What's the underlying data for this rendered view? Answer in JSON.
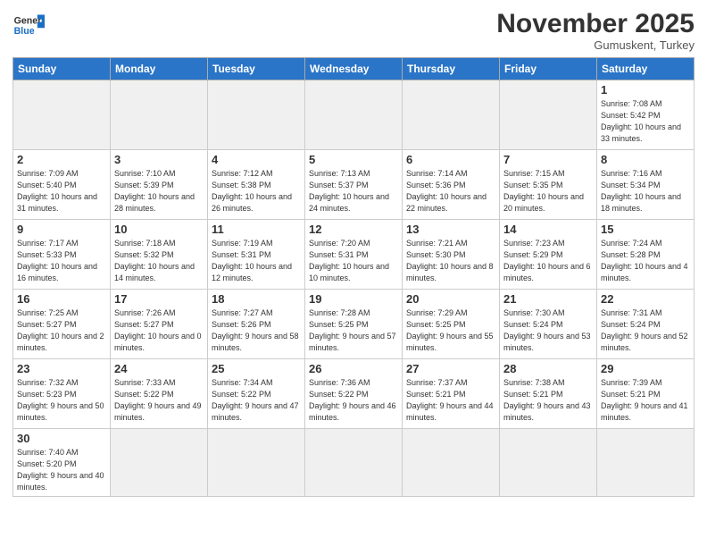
{
  "logo": {
    "general": "General",
    "blue": "Blue"
  },
  "header": {
    "month_year": "November 2025",
    "location": "Gumuskent, Turkey"
  },
  "weekdays": [
    "Sunday",
    "Monday",
    "Tuesday",
    "Wednesday",
    "Thursday",
    "Friday",
    "Saturday"
  ],
  "weeks": [
    [
      {
        "day": "",
        "info": ""
      },
      {
        "day": "",
        "info": ""
      },
      {
        "day": "",
        "info": ""
      },
      {
        "day": "",
        "info": ""
      },
      {
        "day": "",
        "info": ""
      },
      {
        "day": "",
        "info": ""
      },
      {
        "day": "1",
        "info": "Sunrise: 7:08 AM\nSunset: 5:42 PM\nDaylight: 10 hours and 33 minutes."
      }
    ],
    [
      {
        "day": "2",
        "info": "Sunrise: 7:09 AM\nSunset: 5:40 PM\nDaylight: 10 hours and 31 minutes."
      },
      {
        "day": "3",
        "info": "Sunrise: 7:10 AM\nSunset: 5:39 PM\nDaylight: 10 hours and 28 minutes."
      },
      {
        "day": "4",
        "info": "Sunrise: 7:12 AM\nSunset: 5:38 PM\nDaylight: 10 hours and 26 minutes."
      },
      {
        "day": "5",
        "info": "Sunrise: 7:13 AM\nSunset: 5:37 PM\nDaylight: 10 hours and 24 minutes."
      },
      {
        "day": "6",
        "info": "Sunrise: 7:14 AM\nSunset: 5:36 PM\nDaylight: 10 hours and 22 minutes."
      },
      {
        "day": "7",
        "info": "Sunrise: 7:15 AM\nSunset: 5:35 PM\nDaylight: 10 hours and 20 minutes."
      },
      {
        "day": "8",
        "info": "Sunrise: 7:16 AM\nSunset: 5:34 PM\nDaylight: 10 hours and 18 minutes."
      }
    ],
    [
      {
        "day": "9",
        "info": "Sunrise: 7:17 AM\nSunset: 5:33 PM\nDaylight: 10 hours and 16 minutes."
      },
      {
        "day": "10",
        "info": "Sunrise: 7:18 AM\nSunset: 5:32 PM\nDaylight: 10 hours and 14 minutes."
      },
      {
        "day": "11",
        "info": "Sunrise: 7:19 AM\nSunset: 5:31 PM\nDaylight: 10 hours and 12 minutes."
      },
      {
        "day": "12",
        "info": "Sunrise: 7:20 AM\nSunset: 5:31 PM\nDaylight: 10 hours and 10 minutes."
      },
      {
        "day": "13",
        "info": "Sunrise: 7:21 AM\nSunset: 5:30 PM\nDaylight: 10 hours and 8 minutes."
      },
      {
        "day": "14",
        "info": "Sunrise: 7:23 AM\nSunset: 5:29 PM\nDaylight: 10 hours and 6 minutes."
      },
      {
        "day": "15",
        "info": "Sunrise: 7:24 AM\nSunset: 5:28 PM\nDaylight: 10 hours and 4 minutes."
      }
    ],
    [
      {
        "day": "16",
        "info": "Sunrise: 7:25 AM\nSunset: 5:27 PM\nDaylight: 10 hours and 2 minutes."
      },
      {
        "day": "17",
        "info": "Sunrise: 7:26 AM\nSunset: 5:27 PM\nDaylight: 10 hours and 0 minutes."
      },
      {
        "day": "18",
        "info": "Sunrise: 7:27 AM\nSunset: 5:26 PM\nDaylight: 9 hours and 58 minutes."
      },
      {
        "day": "19",
        "info": "Sunrise: 7:28 AM\nSunset: 5:25 PM\nDaylight: 9 hours and 57 minutes."
      },
      {
        "day": "20",
        "info": "Sunrise: 7:29 AM\nSunset: 5:25 PM\nDaylight: 9 hours and 55 minutes."
      },
      {
        "day": "21",
        "info": "Sunrise: 7:30 AM\nSunset: 5:24 PM\nDaylight: 9 hours and 53 minutes."
      },
      {
        "day": "22",
        "info": "Sunrise: 7:31 AM\nSunset: 5:24 PM\nDaylight: 9 hours and 52 minutes."
      }
    ],
    [
      {
        "day": "23",
        "info": "Sunrise: 7:32 AM\nSunset: 5:23 PM\nDaylight: 9 hours and 50 minutes."
      },
      {
        "day": "24",
        "info": "Sunrise: 7:33 AM\nSunset: 5:22 PM\nDaylight: 9 hours and 49 minutes."
      },
      {
        "day": "25",
        "info": "Sunrise: 7:34 AM\nSunset: 5:22 PM\nDaylight: 9 hours and 47 minutes."
      },
      {
        "day": "26",
        "info": "Sunrise: 7:36 AM\nSunset: 5:22 PM\nDaylight: 9 hours and 46 minutes."
      },
      {
        "day": "27",
        "info": "Sunrise: 7:37 AM\nSunset: 5:21 PM\nDaylight: 9 hours and 44 minutes."
      },
      {
        "day": "28",
        "info": "Sunrise: 7:38 AM\nSunset: 5:21 PM\nDaylight: 9 hours and 43 minutes."
      },
      {
        "day": "29",
        "info": "Sunrise: 7:39 AM\nSunset: 5:21 PM\nDaylight: 9 hours and 41 minutes."
      }
    ],
    [
      {
        "day": "30",
        "info": "Sunrise: 7:40 AM\nSunset: 5:20 PM\nDaylight: 9 hours and 40 minutes."
      },
      {
        "day": "",
        "info": ""
      },
      {
        "day": "",
        "info": ""
      },
      {
        "day": "",
        "info": ""
      },
      {
        "day": "",
        "info": ""
      },
      {
        "day": "",
        "info": ""
      },
      {
        "day": "",
        "info": ""
      }
    ]
  ]
}
